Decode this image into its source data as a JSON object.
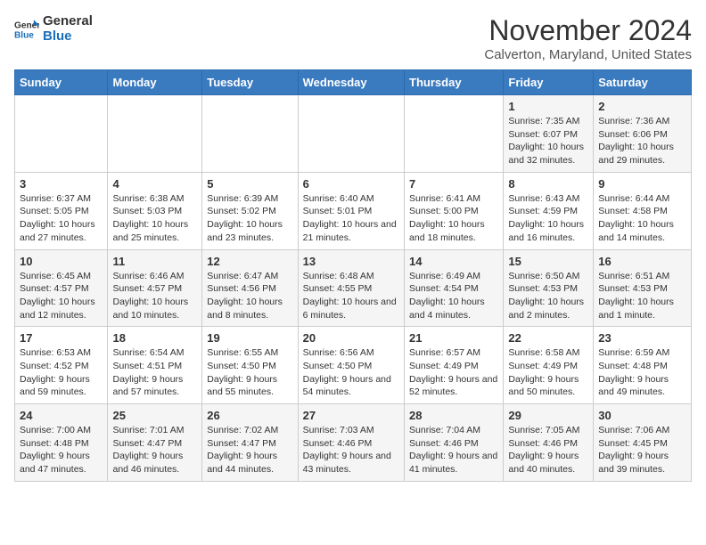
{
  "logo": {
    "line1": "General",
    "line2": "Blue"
  },
  "title": "November 2024",
  "subtitle": "Calverton, Maryland, United States",
  "days_of_week": [
    "Sunday",
    "Monday",
    "Tuesday",
    "Wednesday",
    "Thursday",
    "Friday",
    "Saturday"
  ],
  "weeks": [
    [
      {
        "day": "",
        "detail": ""
      },
      {
        "day": "",
        "detail": ""
      },
      {
        "day": "",
        "detail": ""
      },
      {
        "day": "",
        "detail": ""
      },
      {
        "day": "",
        "detail": ""
      },
      {
        "day": "1",
        "detail": "Sunrise: 7:35 AM\nSunset: 6:07 PM\nDaylight: 10 hours and 32 minutes."
      },
      {
        "day": "2",
        "detail": "Sunrise: 7:36 AM\nSunset: 6:06 PM\nDaylight: 10 hours and 29 minutes."
      }
    ],
    [
      {
        "day": "3",
        "detail": "Sunrise: 6:37 AM\nSunset: 5:05 PM\nDaylight: 10 hours and 27 minutes."
      },
      {
        "day": "4",
        "detail": "Sunrise: 6:38 AM\nSunset: 5:03 PM\nDaylight: 10 hours and 25 minutes."
      },
      {
        "day": "5",
        "detail": "Sunrise: 6:39 AM\nSunset: 5:02 PM\nDaylight: 10 hours and 23 minutes."
      },
      {
        "day": "6",
        "detail": "Sunrise: 6:40 AM\nSunset: 5:01 PM\nDaylight: 10 hours and 21 minutes."
      },
      {
        "day": "7",
        "detail": "Sunrise: 6:41 AM\nSunset: 5:00 PM\nDaylight: 10 hours and 18 minutes."
      },
      {
        "day": "8",
        "detail": "Sunrise: 6:43 AM\nSunset: 4:59 PM\nDaylight: 10 hours and 16 minutes."
      },
      {
        "day": "9",
        "detail": "Sunrise: 6:44 AM\nSunset: 4:58 PM\nDaylight: 10 hours and 14 minutes."
      }
    ],
    [
      {
        "day": "10",
        "detail": "Sunrise: 6:45 AM\nSunset: 4:57 PM\nDaylight: 10 hours and 12 minutes."
      },
      {
        "day": "11",
        "detail": "Sunrise: 6:46 AM\nSunset: 4:57 PM\nDaylight: 10 hours and 10 minutes."
      },
      {
        "day": "12",
        "detail": "Sunrise: 6:47 AM\nSunset: 4:56 PM\nDaylight: 10 hours and 8 minutes."
      },
      {
        "day": "13",
        "detail": "Sunrise: 6:48 AM\nSunset: 4:55 PM\nDaylight: 10 hours and 6 minutes."
      },
      {
        "day": "14",
        "detail": "Sunrise: 6:49 AM\nSunset: 4:54 PM\nDaylight: 10 hours and 4 minutes."
      },
      {
        "day": "15",
        "detail": "Sunrise: 6:50 AM\nSunset: 4:53 PM\nDaylight: 10 hours and 2 minutes."
      },
      {
        "day": "16",
        "detail": "Sunrise: 6:51 AM\nSunset: 4:53 PM\nDaylight: 10 hours and 1 minute."
      }
    ],
    [
      {
        "day": "17",
        "detail": "Sunrise: 6:53 AM\nSunset: 4:52 PM\nDaylight: 9 hours and 59 minutes."
      },
      {
        "day": "18",
        "detail": "Sunrise: 6:54 AM\nSunset: 4:51 PM\nDaylight: 9 hours and 57 minutes."
      },
      {
        "day": "19",
        "detail": "Sunrise: 6:55 AM\nSunset: 4:50 PM\nDaylight: 9 hours and 55 minutes."
      },
      {
        "day": "20",
        "detail": "Sunrise: 6:56 AM\nSunset: 4:50 PM\nDaylight: 9 hours and 54 minutes."
      },
      {
        "day": "21",
        "detail": "Sunrise: 6:57 AM\nSunset: 4:49 PM\nDaylight: 9 hours and 52 minutes."
      },
      {
        "day": "22",
        "detail": "Sunrise: 6:58 AM\nSunset: 4:49 PM\nDaylight: 9 hours and 50 minutes."
      },
      {
        "day": "23",
        "detail": "Sunrise: 6:59 AM\nSunset: 4:48 PM\nDaylight: 9 hours and 49 minutes."
      }
    ],
    [
      {
        "day": "24",
        "detail": "Sunrise: 7:00 AM\nSunset: 4:48 PM\nDaylight: 9 hours and 47 minutes."
      },
      {
        "day": "25",
        "detail": "Sunrise: 7:01 AM\nSunset: 4:47 PM\nDaylight: 9 hours and 46 minutes."
      },
      {
        "day": "26",
        "detail": "Sunrise: 7:02 AM\nSunset: 4:47 PM\nDaylight: 9 hours and 44 minutes."
      },
      {
        "day": "27",
        "detail": "Sunrise: 7:03 AM\nSunset: 4:46 PM\nDaylight: 9 hours and 43 minutes."
      },
      {
        "day": "28",
        "detail": "Sunrise: 7:04 AM\nSunset: 4:46 PM\nDaylight: 9 hours and 41 minutes."
      },
      {
        "day": "29",
        "detail": "Sunrise: 7:05 AM\nSunset: 4:46 PM\nDaylight: 9 hours and 40 minutes."
      },
      {
        "day": "30",
        "detail": "Sunrise: 7:06 AM\nSunset: 4:45 PM\nDaylight: 9 hours and 39 minutes."
      }
    ]
  ]
}
